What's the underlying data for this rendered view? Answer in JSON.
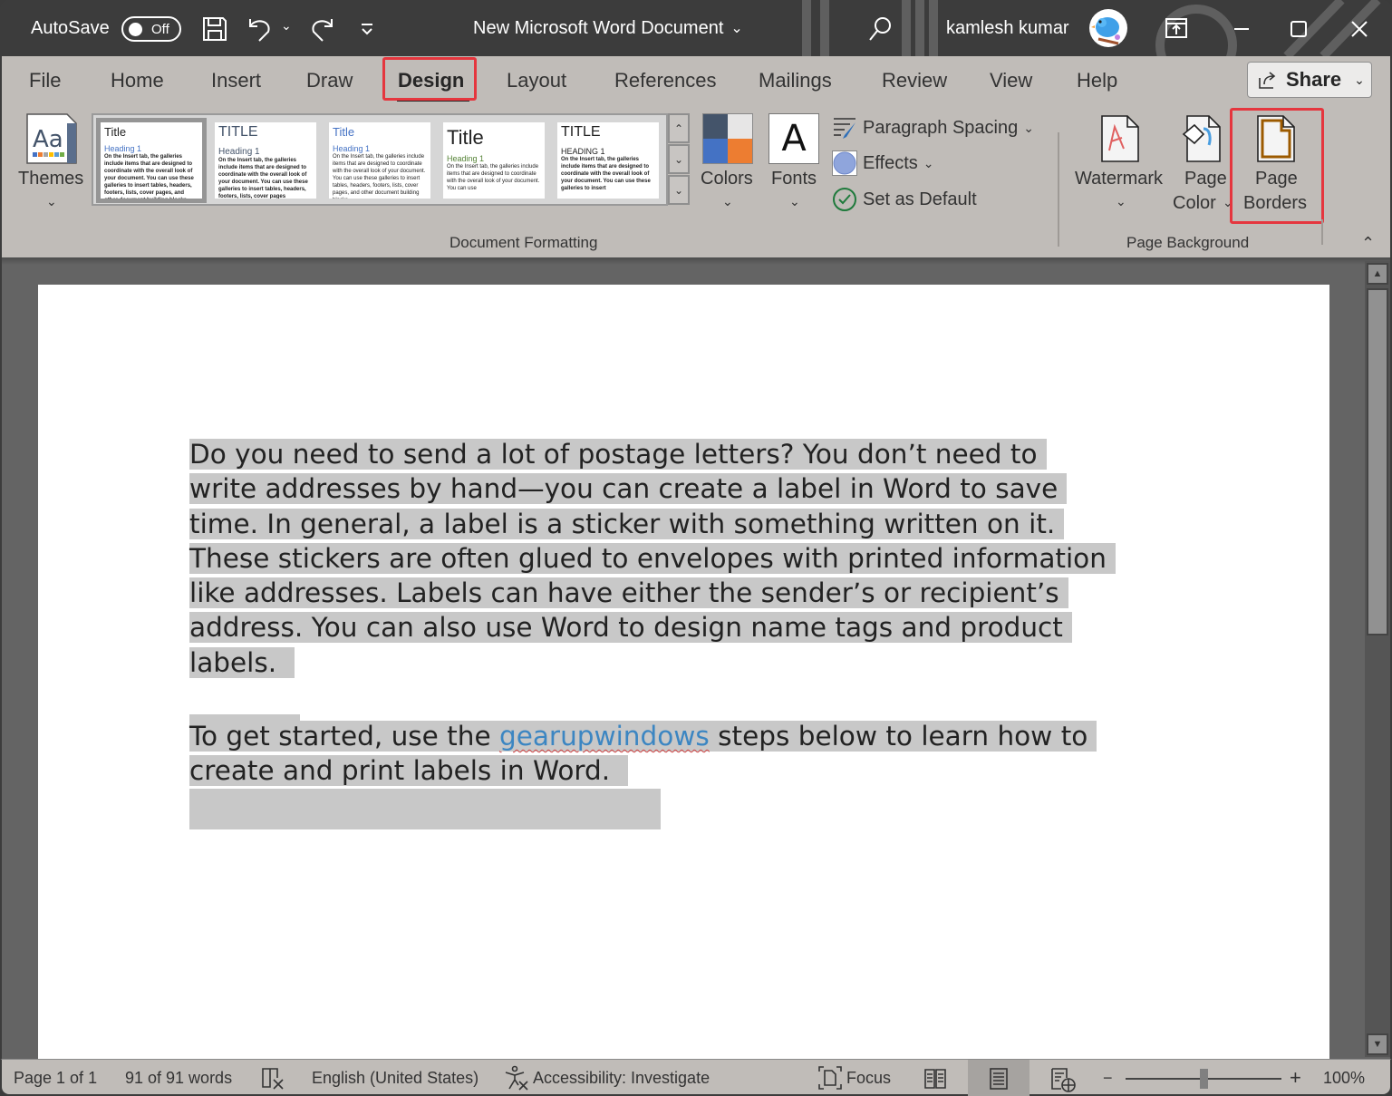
{
  "titlebar": {
    "autosave_label": "AutoSave",
    "autosave_state": "Off",
    "document_title": "New Microsoft Word Document",
    "user_name": "kamlesh kumar",
    "icons": [
      "save-icon",
      "undo-icon",
      "redo-icon",
      "customize-toolbar-icon",
      "search-icon",
      "ribbon-display-icon",
      "minimize-icon",
      "maximize-icon",
      "close-icon"
    ]
  },
  "ribbon": {
    "tabs": [
      "File",
      "Home",
      "Insert",
      "Draw",
      "Design",
      "Layout",
      "References",
      "Mailings",
      "Review",
      "View",
      "Help"
    ],
    "active_tab": "Design",
    "share_label": "Share",
    "themes_label": "Themes",
    "style_gallery": [
      {
        "title": "Title",
        "heading": "Heading 1",
        "body": "On the Insert tab, the galleries include items that are designed to coordinate with the overall look of your document. You can use these galleries to insert tables, headers, footers, lists, cover pages, and other document building blocks."
      },
      {
        "title": "TITLE",
        "heading": "Heading 1",
        "body": "On the Insert tab, the galleries include items that are designed to coordinate with the overall look of your document. You can use these galleries to insert tables, headers, footers, lists, cover pages"
      },
      {
        "title": "Title",
        "heading": "Heading 1",
        "body": "On the Insert tab, the galleries include items that are designed to coordinate with the overall look of your document. You can use these galleries to insert tables, headers, footers, lists, cover pages, and other document building blocks."
      },
      {
        "title": "Title",
        "heading": "Heading 1",
        "body": "On the Insert tab, the galleries include items that are designed to coordinate with the overall look of your document. You can use"
      },
      {
        "title": "TITLE",
        "heading": "HEADING 1",
        "body": "On the Insert tab, the galleries include items that are designed to coordinate with the overall look of your document. You can use these galleries to insert"
      }
    ],
    "colors_label": "Colors",
    "fonts_label": "Fonts",
    "fonts_glyph": "A",
    "paragraph_spacing_label": "Paragraph Spacing",
    "effects_label": "Effects",
    "set_default_label": "Set as Default",
    "document_formatting_label": "Document Formatting",
    "watermark_label": "Watermark",
    "page_color_label_1": "Page",
    "page_color_label_2": "Color",
    "page_borders_label_1": "Page",
    "page_borders_label_2": "Borders",
    "page_background_label": "Page Background",
    "theme_colors": [
      "#44546a",
      "#e7e6e6",
      "#4472c4",
      "#ed7d31"
    ]
  },
  "document": {
    "paragraph1_lines": [
      "Do you need to send a lot of postage letters? You don’t need to",
      "write addresses by hand—you can create a label in Word to save",
      "time. In general, a label is a sticker with something written on it.",
      "These stickers are often glued to envelopes with printed information",
      "like addresses. Labels can have either the sender’s or recipient’s",
      "address. You can also use Word to design name tags and product",
      "labels."
    ],
    "paragraph2_before_link": "To get started, use the ",
    "paragraph2_link": "gearupwindows",
    "paragraph2_after_link": " steps below to learn how to",
    "paragraph2_line2": "create and print labels in Word."
  },
  "statusbar": {
    "page": "Page 1 of 1",
    "words": "91 of 91 words",
    "language": "English (United States)",
    "accessibility": "Accessibility: Investigate",
    "focus": "Focus",
    "zoom_minus": "−",
    "zoom_plus": "+",
    "zoom_level": "100%",
    "zoom_percent": 100
  },
  "colors": {
    "accent_red_highlight": "#e5363e",
    "titlebar_bg": "#3c3c3c",
    "ribbon_bg": "#c0bcb8",
    "link": "#3c86c2",
    "selection": "#c8c8c8"
  }
}
